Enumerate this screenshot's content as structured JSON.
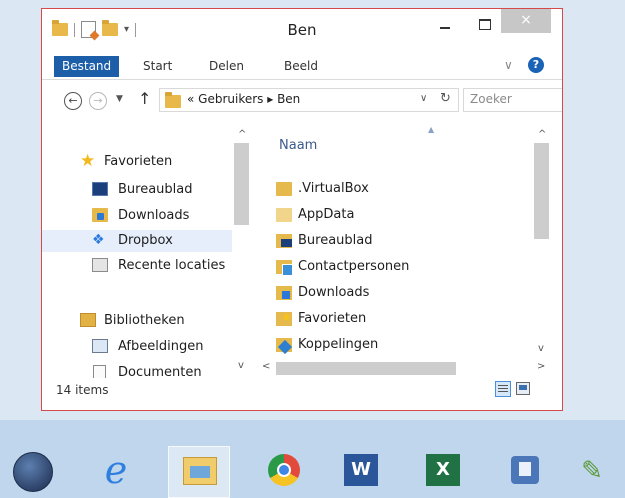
{
  "window": {
    "title": "Ben",
    "close_glyph": "×"
  },
  "ribbon": {
    "tabs": [
      "Bestand",
      "Start",
      "Delen",
      "Beeld"
    ],
    "collapse_glyph": "∨",
    "help_glyph": "?"
  },
  "nav": {
    "back_glyph": "←",
    "forward_glyph": "→",
    "recent_glyph": "▼",
    "up_glyph": "↑",
    "address": "« Gebruikers ▸ Ben",
    "address_drop_glyph": "∨",
    "refresh_glyph": "↻",
    "search_placeholder": "Zoeker"
  },
  "navpane": {
    "items": [
      {
        "label": "Favorieten",
        "icon": "star-icon",
        "selected": false
      },
      {
        "label": "Bureaublad",
        "icon": "desktop-icon",
        "selected": false
      },
      {
        "label": "Downloads",
        "icon": "downloads-icon",
        "selected": false
      },
      {
        "label": "Dropbox",
        "icon": "dropbox-icon",
        "selected": true
      },
      {
        "label": "Recente locaties",
        "icon": "recent-places-icon",
        "selected": false
      },
      {
        "label": "Bibliotheken",
        "icon": "libraries-icon",
        "selected": false
      },
      {
        "label": "Afbeeldingen",
        "icon": "pictures-icon",
        "selected": false
      },
      {
        "label": "Documenten",
        "icon": "documents-icon",
        "selected": false
      }
    ]
  },
  "content": {
    "column_header": "Naam",
    "sort_glyph": "▲",
    "files": [
      {
        "label": ".VirtualBox",
        "icon": "folder-icon"
      },
      {
        "label": "AppData",
        "icon": "folder-hidden-icon"
      },
      {
        "label": "Bureaublad",
        "icon": "desktop-folder-icon"
      },
      {
        "label": "Contactpersonen",
        "icon": "contacts-folder-icon"
      },
      {
        "label": "Downloads",
        "icon": "downloads-folder-icon"
      },
      {
        "label": "Favorieten",
        "icon": "favorites-folder-icon"
      },
      {
        "label": "Koppelingen",
        "icon": "links-folder-icon"
      }
    ]
  },
  "scroll_glyphs": {
    "up": "^",
    "down": "v",
    "left": "<",
    "right": ">"
  },
  "status": {
    "item_count": "14 items"
  },
  "taskbar": {
    "apps": [
      "start-orb",
      "internet-explorer-icon",
      "file-explorer-icon",
      "chrome-icon",
      "word-icon",
      "excel-icon",
      "app-icon",
      "tool-icon"
    ],
    "word_letter": "W",
    "excel_letter": "X",
    "ie_letter": "e",
    "tool_glyph": "✎"
  },
  "colors": {
    "accent": "#1c5ea8",
    "window_border": "#d44a4a",
    "selection": "#e6eefb"
  }
}
